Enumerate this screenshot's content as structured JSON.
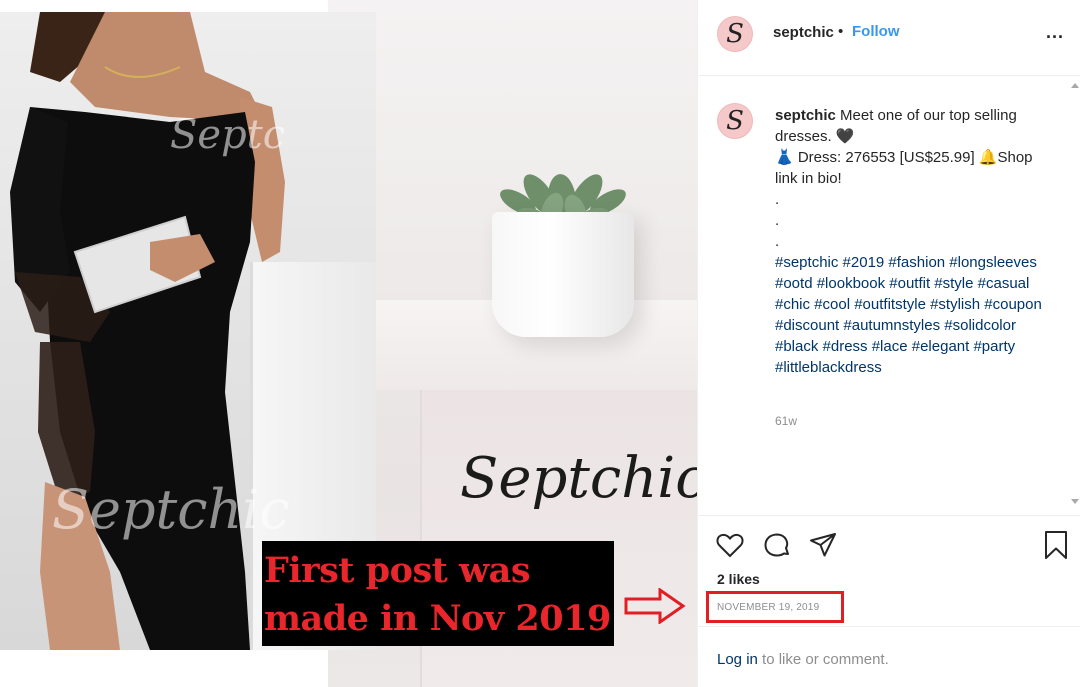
{
  "image": {
    "brand_overlay": "Septchic",
    "watermarks": [
      "Septc",
      "Septchic"
    ],
    "note_lines": [
      "First post was",
      "made in Nov 2019"
    ]
  },
  "post": {
    "username": "septchic",
    "avatar_letter": "S",
    "separator": "•",
    "follow_label": "Follow",
    "more_label": "...",
    "caption": {
      "username": "septchic",
      "line1": " Meet one of our top selling dresses. 🖤",
      "line2": "👗 Dress: 276553 [US$25.99] 🔔Shop link in bio!",
      "dots": [
        ".",
        ".",
        "."
      ],
      "hashtags": "#septchic #2019 #fashion #longsleeves #ootd #lookbook #outfit #style #casual #chic #cool #outfitstyle #stylish #coupon #discount #autumnstyles #solidcolor #black #dress #lace #elegant #party #littleblackdress"
    },
    "time_ago": "61w",
    "likes": "2 likes",
    "date": "NOVEMBER 19, 2019",
    "login_link": "Log in",
    "login_rest": " to like or comment."
  },
  "colors": {
    "follow": "#3897f0",
    "hashtag": "#003569",
    "highlight": "#e01e24",
    "note_text": "#e8262b"
  },
  "icons": [
    "heart-icon",
    "comment-icon",
    "share-icon",
    "bookmark-icon",
    "arrow-icon"
  ]
}
